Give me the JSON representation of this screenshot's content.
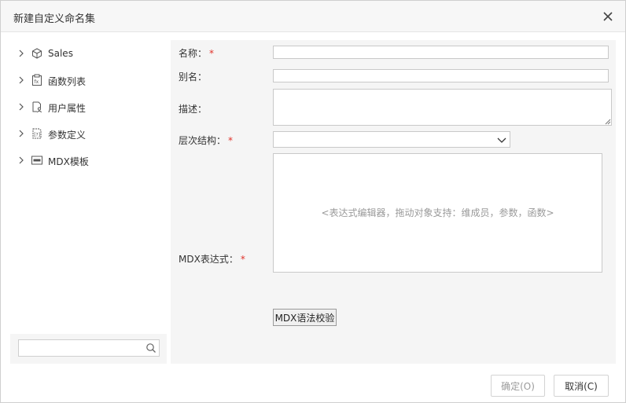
{
  "dialog": {
    "title": "新建自定义命名集",
    "close_icon": "close-icon"
  },
  "tree": {
    "items": [
      {
        "label": "Sales",
        "icon": "cube-icon"
      },
      {
        "label": "函数列表",
        "icon": "function-list-icon"
      },
      {
        "label": "用户属性",
        "icon": "user-attribute-icon"
      },
      {
        "label": "参数定义",
        "icon": "parameter-icon"
      },
      {
        "label": "MDX模板",
        "icon": "mdx-template-icon"
      }
    ]
  },
  "search": {
    "value": "",
    "icon": "search-icon"
  },
  "form": {
    "name_label": "名称：",
    "name_value": "",
    "alias_label": "别名：",
    "alias_value": "",
    "desc_label": "描述：",
    "desc_value": "",
    "hierarchy_label": "层次结构：",
    "hierarchy_value": "",
    "mdx_label": "MDX表达式：",
    "required_mark": "*",
    "editor_placeholder": "<表达式编辑器，拖动对象支持：维成员，参数，函数>",
    "validate_button": "MDX语法校验"
  },
  "footer": {
    "ok_button": "确定(O)",
    "cancel_button": "取消(C)"
  },
  "colors": {
    "required": "#e0322a",
    "panel_bg": "#f5f5f5",
    "border": "#c9c9c9"
  }
}
